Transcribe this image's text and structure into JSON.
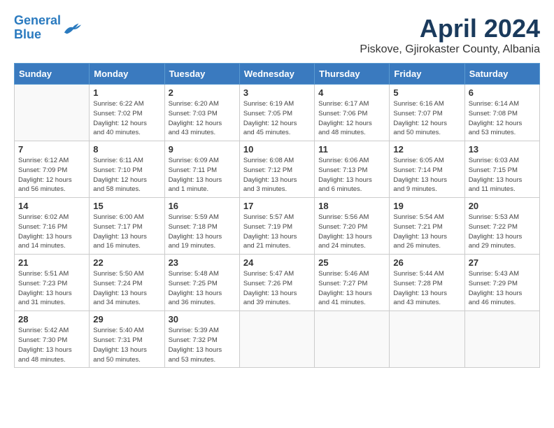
{
  "header": {
    "logo_line1": "General",
    "logo_line2": "Blue",
    "month_year": "April 2024",
    "location": "Piskove, Gjirokaster County, Albania"
  },
  "weekdays": [
    "Sunday",
    "Monday",
    "Tuesday",
    "Wednesday",
    "Thursday",
    "Friday",
    "Saturday"
  ],
  "weeks": [
    [
      {
        "day": "",
        "info": ""
      },
      {
        "day": "1",
        "info": "Sunrise: 6:22 AM\nSunset: 7:02 PM\nDaylight: 12 hours\nand 40 minutes."
      },
      {
        "day": "2",
        "info": "Sunrise: 6:20 AM\nSunset: 7:03 PM\nDaylight: 12 hours\nand 43 minutes."
      },
      {
        "day": "3",
        "info": "Sunrise: 6:19 AM\nSunset: 7:05 PM\nDaylight: 12 hours\nand 45 minutes."
      },
      {
        "day": "4",
        "info": "Sunrise: 6:17 AM\nSunset: 7:06 PM\nDaylight: 12 hours\nand 48 minutes."
      },
      {
        "day": "5",
        "info": "Sunrise: 6:16 AM\nSunset: 7:07 PM\nDaylight: 12 hours\nand 50 minutes."
      },
      {
        "day": "6",
        "info": "Sunrise: 6:14 AM\nSunset: 7:08 PM\nDaylight: 12 hours\nand 53 minutes."
      }
    ],
    [
      {
        "day": "7",
        "info": "Sunrise: 6:12 AM\nSunset: 7:09 PM\nDaylight: 12 hours\nand 56 minutes."
      },
      {
        "day": "8",
        "info": "Sunrise: 6:11 AM\nSunset: 7:10 PM\nDaylight: 12 hours\nand 58 minutes."
      },
      {
        "day": "9",
        "info": "Sunrise: 6:09 AM\nSunset: 7:11 PM\nDaylight: 13 hours\nand 1 minute."
      },
      {
        "day": "10",
        "info": "Sunrise: 6:08 AM\nSunset: 7:12 PM\nDaylight: 13 hours\nand 3 minutes."
      },
      {
        "day": "11",
        "info": "Sunrise: 6:06 AM\nSunset: 7:13 PM\nDaylight: 13 hours\nand 6 minutes."
      },
      {
        "day": "12",
        "info": "Sunrise: 6:05 AM\nSunset: 7:14 PM\nDaylight: 13 hours\nand 9 minutes."
      },
      {
        "day": "13",
        "info": "Sunrise: 6:03 AM\nSunset: 7:15 PM\nDaylight: 13 hours\nand 11 minutes."
      }
    ],
    [
      {
        "day": "14",
        "info": "Sunrise: 6:02 AM\nSunset: 7:16 PM\nDaylight: 13 hours\nand 14 minutes."
      },
      {
        "day": "15",
        "info": "Sunrise: 6:00 AM\nSunset: 7:17 PM\nDaylight: 13 hours\nand 16 minutes."
      },
      {
        "day": "16",
        "info": "Sunrise: 5:59 AM\nSunset: 7:18 PM\nDaylight: 13 hours\nand 19 minutes."
      },
      {
        "day": "17",
        "info": "Sunrise: 5:57 AM\nSunset: 7:19 PM\nDaylight: 13 hours\nand 21 minutes."
      },
      {
        "day": "18",
        "info": "Sunrise: 5:56 AM\nSunset: 7:20 PM\nDaylight: 13 hours\nand 24 minutes."
      },
      {
        "day": "19",
        "info": "Sunrise: 5:54 AM\nSunset: 7:21 PM\nDaylight: 13 hours\nand 26 minutes."
      },
      {
        "day": "20",
        "info": "Sunrise: 5:53 AM\nSunset: 7:22 PM\nDaylight: 13 hours\nand 29 minutes."
      }
    ],
    [
      {
        "day": "21",
        "info": "Sunrise: 5:51 AM\nSunset: 7:23 PM\nDaylight: 13 hours\nand 31 minutes."
      },
      {
        "day": "22",
        "info": "Sunrise: 5:50 AM\nSunset: 7:24 PM\nDaylight: 13 hours\nand 34 minutes."
      },
      {
        "day": "23",
        "info": "Sunrise: 5:48 AM\nSunset: 7:25 PM\nDaylight: 13 hours\nand 36 minutes."
      },
      {
        "day": "24",
        "info": "Sunrise: 5:47 AM\nSunset: 7:26 PM\nDaylight: 13 hours\nand 39 minutes."
      },
      {
        "day": "25",
        "info": "Sunrise: 5:46 AM\nSunset: 7:27 PM\nDaylight: 13 hours\nand 41 minutes."
      },
      {
        "day": "26",
        "info": "Sunrise: 5:44 AM\nSunset: 7:28 PM\nDaylight: 13 hours\nand 43 minutes."
      },
      {
        "day": "27",
        "info": "Sunrise: 5:43 AM\nSunset: 7:29 PM\nDaylight: 13 hours\nand 46 minutes."
      }
    ],
    [
      {
        "day": "28",
        "info": "Sunrise: 5:42 AM\nSunset: 7:30 PM\nDaylight: 13 hours\nand 48 minutes."
      },
      {
        "day": "29",
        "info": "Sunrise: 5:40 AM\nSunset: 7:31 PM\nDaylight: 13 hours\nand 50 minutes."
      },
      {
        "day": "30",
        "info": "Sunrise: 5:39 AM\nSunset: 7:32 PM\nDaylight: 13 hours\nand 53 minutes."
      },
      {
        "day": "",
        "info": ""
      },
      {
        "day": "",
        "info": ""
      },
      {
        "day": "",
        "info": ""
      },
      {
        "day": "",
        "info": ""
      }
    ]
  ]
}
